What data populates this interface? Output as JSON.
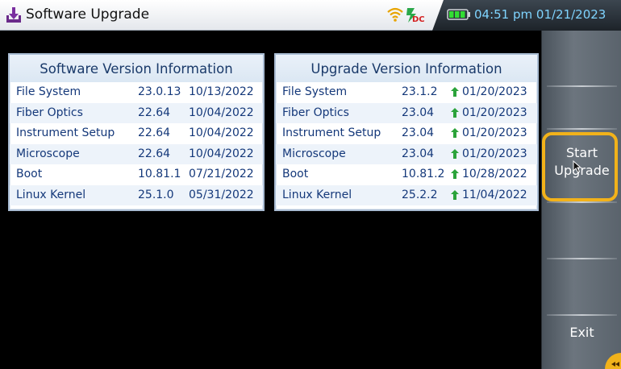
{
  "window": {
    "title": "Software Upgrade",
    "icon": "download-arrow-icon"
  },
  "status_bar": {
    "clock": "04:51 pm 01/21/2023",
    "icons": [
      "wifi-icon",
      "dc-power-icon",
      "battery-icon"
    ],
    "colors": {
      "clock_text": "#7fd4ff",
      "battery": "#33dd33"
    }
  },
  "software_panel": {
    "title": "Software Version Information",
    "rows": [
      {
        "name": "File System",
        "version": "23.0.13",
        "date": "10/13/2022"
      },
      {
        "name": "Fiber Optics",
        "version": "22.64",
        "date": "10/04/2022"
      },
      {
        "name": "Instrument Setup",
        "version": "22.64",
        "date": "10/04/2022"
      },
      {
        "name": "Microscope",
        "version": "22.64",
        "date": "10/04/2022"
      },
      {
        "name": "Boot",
        "version": "10.81.1",
        "date": "07/21/2022"
      },
      {
        "name": "Linux Kernel",
        "version": "25.1.0",
        "date": "05/31/2022"
      }
    ]
  },
  "upgrade_panel": {
    "title": "Upgrade Version Information",
    "rows": [
      {
        "name": "File System",
        "version": "23.1.2",
        "date": "01/20/2023",
        "indicator": "up-arrow-icon"
      },
      {
        "name": "Fiber Optics",
        "version": "23.04",
        "date": "01/20/2023",
        "indicator": "up-arrow-icon"
      },
      {
        "name": "Instrument Setup",
        "version": "23.04",
        "date": "01/20/2023",
        "indicator": "up-arrow-icon"
      },
      {
        "name": "Microscope",
        "version": "23.04",
        "date": "01/20/2023",
        "indicator": "up-arrow-icon"
      },
      {
        "name": "Boot",
        "version": "10.81.2",
        "date": "10/28/2022",
        "indicator": "up-arrow-icon"
      },
      {
        "name": "Linux Kernel",
        "version": "25.2.2",
        "date": "11/04/2022",
        "indicator": "up-arrow-icon"
      }
    ]
  },
  "softkeys": {
    "start_upgrade_line1": "Start",
    "start_upgrade_line2": "Upgrade",
    "exit": "Exit",
    "highlight_color": "#f2b21a"
  }
}
